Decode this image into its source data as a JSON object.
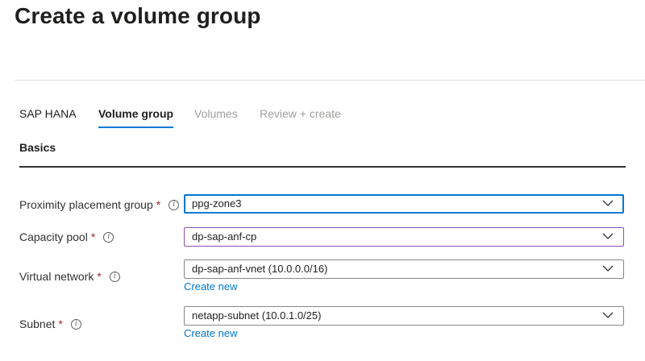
{
  "page": {
    "title": "Create a volume group",
    "more_label": "···"
  },
  "tabs": [
    {
      "label": "SAP HANA",
      "state": "done"
    },
    {
      "label": "Volume group",
      "state": "active"
    },
    {
      "label": "Volumes",
      "state": "disabled"
    },
    {
      "label": "Review + create",
      "state": "disabled"
    }
  ],
  "section": {
    "title": "Basics"
  },
  "form": {
    "proximity": {
      "label": "Proximity placement group",
      "required": "*",
      "info": "i",
      "value": "ppg-zone3"
    },
    "capacity": {
      "label": "Capacity pool",
      "required": "*",
      "info": "i",
      "value": "dp-sap-anf-cp"
    },
    "vnet": {
      "label": "Virtual network",
      "required": "*",
      "info": "i",
      "value": "dp-sap-anf-vnet (10.0.0.0/16)",
      "create_link": "Create new"
    },
    "subnet": {
      "label": "Subnet",
      "required": "*",
      "info": "i",
      "value": "netapp-subnet (10.0.1.0/25)",
      "create_link": "Create new"
    }
  },
  "colors": {
    "accent": "#0078d4",
    "required": "#a4262c",
    "focus_purple": "#8c4fa8"
  },
  "icons": {
    "more": "more-horizontal-icon",
    "info": "info-icon",
    "chevron": "chevron-down-icon"
  }
}
